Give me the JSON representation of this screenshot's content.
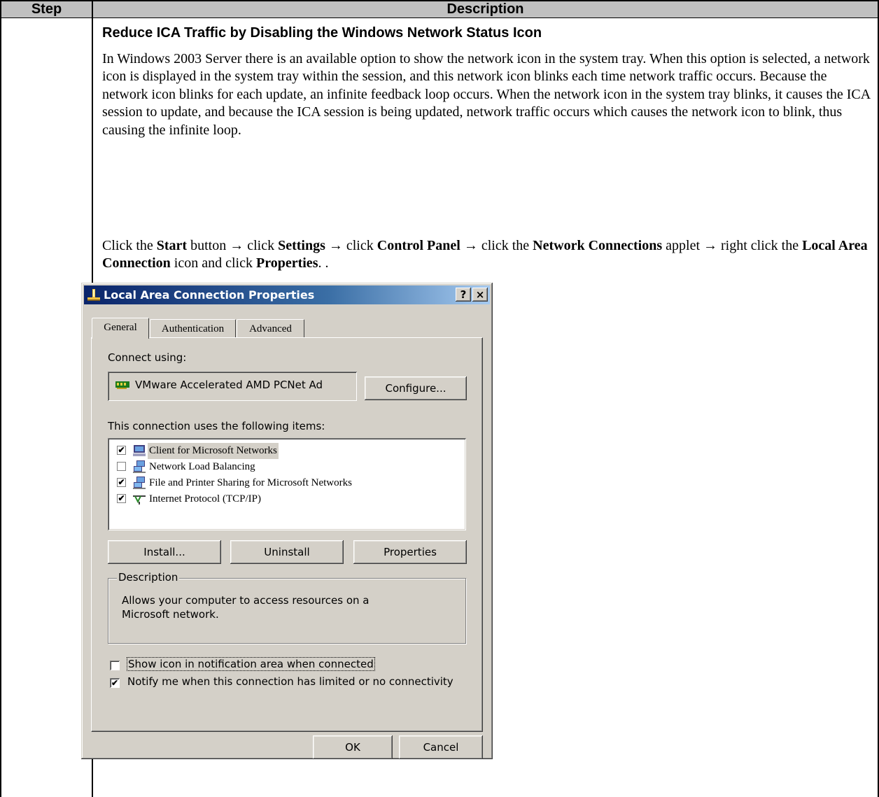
{
  "table": {
    "col_step": "Step",
    "col_description": "Description"
  },
  "section": {
    "title": "Reduce ICA Traffic by Disabling the Windows Network Status Icon",
    "paragraph1": "In Windows 2003 Server there is an available option to show the network icon in the system tray. When this option is selected, a network icon is displayed in the system tray within the session, and this network icon blinks each time network traffic occurs. Because the network icon blinks for each update, an infinite feedback loop occurs. When the network icon in the system tray blinks, it causes the ICA session to update, and because the ICA session is being updated, network traffic occurs which causes the network icon to blink, thus causing the infinite loop.",
    "instruction": {
      "t1": "Click the ",
      "start": "Start",
      "t2": " button → click ",
      "settings": "Settings",
      "t3": " → click ",
      "control_panel": "Control Panel",
      "t4": " → click the ",
      "network_connections": "Network Connections",
      "t5": " applet → right click the ",
      "lac": "Local Area Connection",
      "t6": " icon and click ",
      "properties": "Properties",
      "t7": ". ."
    }
  },
  "dialog": {
    "title": "Local Area Connection Properties",
    "help_btn": "?",
    "close_btn": "×",
    "tabs": [
      "General",
      "Authentication",
      "Advanced"
    ],
    "connect_using_label": "Connect using:",
    "adapter_name": "VMware Accelerated AMD PCNet Ad",
    "configure_btn": "Configure...",
    "items_label": "This connection uses the following items:",
    "items": [
      {
        "label": "Client for Microsoft Networks",
        "checked": true,
        "icon": "network-client-icon"
      },
      {
        "label": "Network Load Balancing",
        "checked": false,
        "icon": "network-service-icon"
      },
      {
        "label": "File and Printer Sharing for Microsoft Networks",
        "checked": true,
        "icon": "network-service-icon"
      },
      {
        "label": "Internet Protocol (TCP/IP)",
        "checked": true,
        "icon": "protocol-icon"
      }
    ],
    "install_btn": "Install...",
    "uninstall_btn": "Uninstall",
    "properties_btn": "Properties",
    "description_legend": "Description",
    "description_text": "Allows your computer to access resources on a Microsoft network.",
    "show_icon_label": "Show icon in notification area when connected",
    "show_icon_checked": false,
    "notify_label": "Notify me when this connection has limited or no connectivity",
    "notify_checked": true,
    "ok_btn": "OK",
    "cancel_btn": "Cancel",
    "check_mark": "✔"
  }
}
